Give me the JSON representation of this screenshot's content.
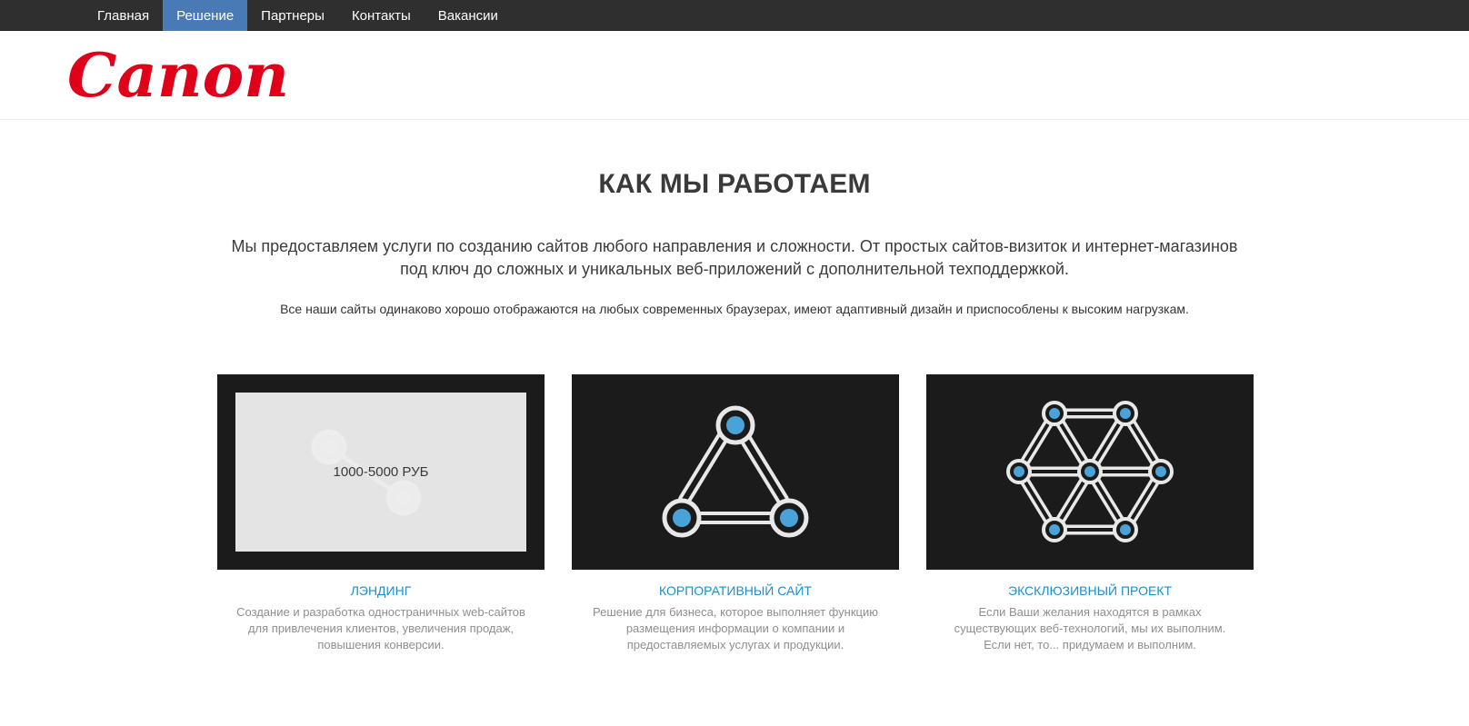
{
  "nav": {
    "items": [
      {
        "label": "Главная",
        "active": false
      },
      {
        "label": "Решение",
        "active": true
      },
      {
        "label": "Партнеры",
        "active": false
      },
      {
        "label": "Контакты",
        "active": false
      },
      {
        "label": "Вакансии",
        "active": false
      }
    ]
  },
  "brand": {
    "logo_text": "Canon",
    "color": "#e0001a"
  },
  "section": {
    "title": "КАК МЫ РАБОТАЕМ",
    "lead": "Мы предоставляем услуги по созданию сайтов любого направления и сложности. От простых сайтов-визиток и интернет-магазинов под ключ до сложных и уникальных веб-приложений с дополнительной техподдержкой.",
    "note": "Все наши сайты одинаково хорошо отображаются на любых современных браузерах, имеют адаптивный дизайн и приспособлены к высоким нагрузкам."
  },
  "cards": [
    {
      "title": "ЛЭНДИНГ",
      "overlay": "1000-5000 РУБ",
      "description": "Создание и разработка одностраничных web-сайтов для привлечения клиентов, увеличения продаж, повышения конверсии.",
      "icon": "two-node-link-icon"
    },
    {
      "title": "КОРПОРАТИВНЫЙ САЙТ",
      "description": "Решение для бизнеса, которое выполняет функцию размещения информации о компании и предоставляемых услугах и продукции.",
      "icon": "triangle-network-icon"
    },
    {
      "title": "ЭКСКЛЮЗИВНЫЙ ПРОЕКТ",
      "description": "Если Ваши желания находятся в рамках существующих веб-технологий, мы их выполним. Если нет, то... придумаем и выполним.",
      "icon": "hex-network-icon"
    }
  ],
  "colors": {
    "nav_bg": "#2f2f2f",
    "nav_active": "#4a7ab5",
    "accent": "#1b8fce",
    "node": "#4aa3d8"
  }
}
